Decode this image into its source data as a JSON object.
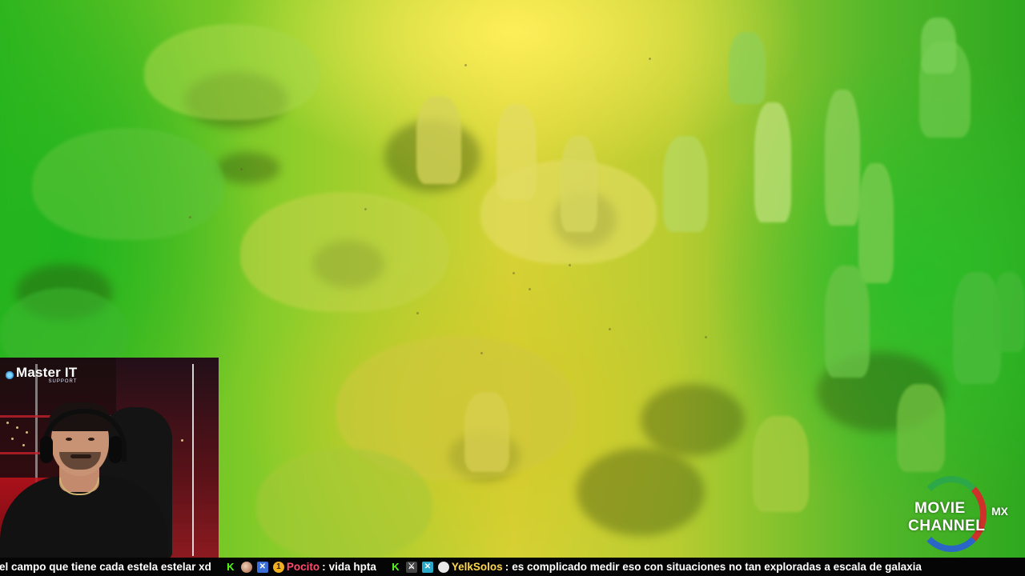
{
  "webcam": {
    "logo_text": "Master IT",
    "logo_sub": "SUPPORT"
  },
  "watermark": {
    "line1": "MOVIE",
    "line2": "CHANNEL",
    "suffix": "MX",
    "colors": [
      "#2ca84a",
      "#d52b2b",
      "#2a63d0"
    ]
  },
  "chat_ticker": {
    "messages": [
      {
        "user": "",
        "text": "el campo que tiene cada estela estelar xd",
        "badges": []
      },
      {
        "user": "Pocito",
        "text": "vida hpta",
        "badges": [
          "kick-icon",
          "face-icon",
          "blue-badge-icon",
          "coin-icon"
        ]
      },
      {
        "user": "YelkSolos",
        "text": "es complicado medir eso con situaciones no tan exploradas a escala de galaxia",
        "badges": [
          "kick-icon",
          "sword-icon",
          "box-badge-icon",
          "skull-icon"
        ]
      }
    ],
    "separator": ":",
    "coin_label": "1",
    "user_colors": [
      "#ff4b6e",
      "#ffd84a"
    ]
  }
}
